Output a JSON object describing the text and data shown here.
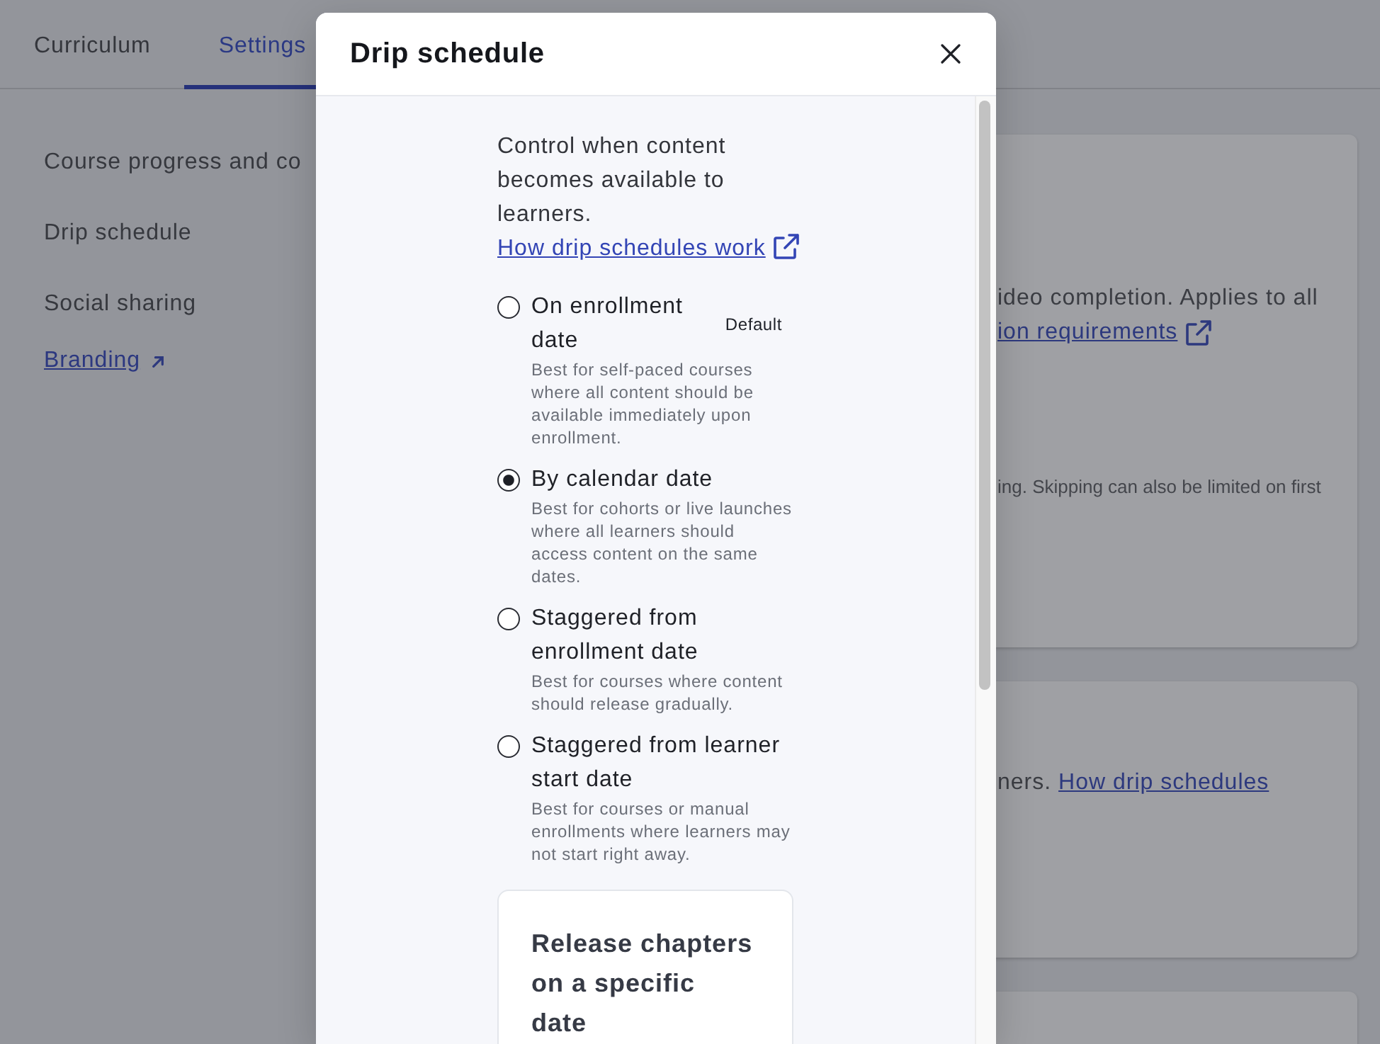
{
  "tabs": [
    {
      "label": "Curriculum",
      "selected": false
    },
    {
      "label": "Settings",
      "selected": true
    }
  ],
  "sidebar": {
    "items": [
      {
        "label": "Course progress and co",
        "kind": "item"
      },
      {
        "label": "Drip schedule",
        "kind": "item"
      },
      {
        "label": "Social sharing",
        "kind": "item"
      },
      {
        "label": "Branding",
        "kind": "link"
      }
    ]
  },
  "cards": [
    {
      "blocks": [
        {
          "kind": "text",
          "text": "ideo completion. Applies to all"
        },
        {
          "kind": "link",
          "text": "ion requirements",
          "external": true
        },
        {
          "kind": "note",
          "text": "ing. Skipping can also be limited on first"
        }
      ]
    },
    {
      "blocks": [
        {
          "kind": "text",
          "text": "ners.",
          "link": "How drip schedules"
        }
      ]
    }
  ],
  "dialog": {
    "title": "Drip schedule",
    "intro": {
      "text": "Control when content becomes available to learners.",
      "link": "How drip schedules work",
      "external": true
    },
    "options": [
      {
        "label": "On enrollment date",
        "badge": "Default",
        "description": "Best for self-paced courses where all content should be available immediately upon enrollment.",
        "selected": false
      },
      {
        "label": "By calendar date",
        "description": "Best for cohorts or live launches where all learners should access content on the same dates.",
        "selected": true
      },
      {
        "label": "Staggered from enrollment date",
        "description": "Best for courses where content should release gradually.",
        "selected": false
      },
      {
        "label": "Staggered from learner start date",
        "description": "Best for courses or manual enrollments where learners may not start right away.",
        "selected": false
      }
    ],
    "release_card": {
      "title": "Release chapters on a specific date"
    }
  }
}
